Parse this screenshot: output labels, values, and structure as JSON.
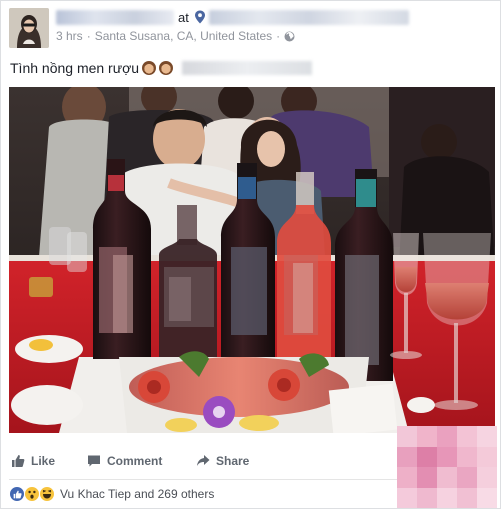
{
  "post": {
    "at": "at",
    "time": "3 hrs",
    "location": "Santa Susana, CA, United States",
    "separator": "·",
    "text": "Tình nồng men rượu"
  },
  "actions": {
    "like": "Like",
    "comment": "Comment",
    "share": "Share"
  },
  "reactions": {
    "summary": "Vu Khac Tiep and 269 others",
    "types": [
      "like",
      "wow",
      "haha"
    ]
  },
  "icons": {
    "location": "pin-icon",
    "privacy": "globe-icon",
    "like": "thumbs-up-icon",
    "comment": "comment-icon",
    "share": "share-arrow-icon"
  },
  "colors": {
    "text": "#1d2129",
    "meta": "#90949c",
    "action": "#606770",
    "facebook_blue": "#4267b2"
  }
}
